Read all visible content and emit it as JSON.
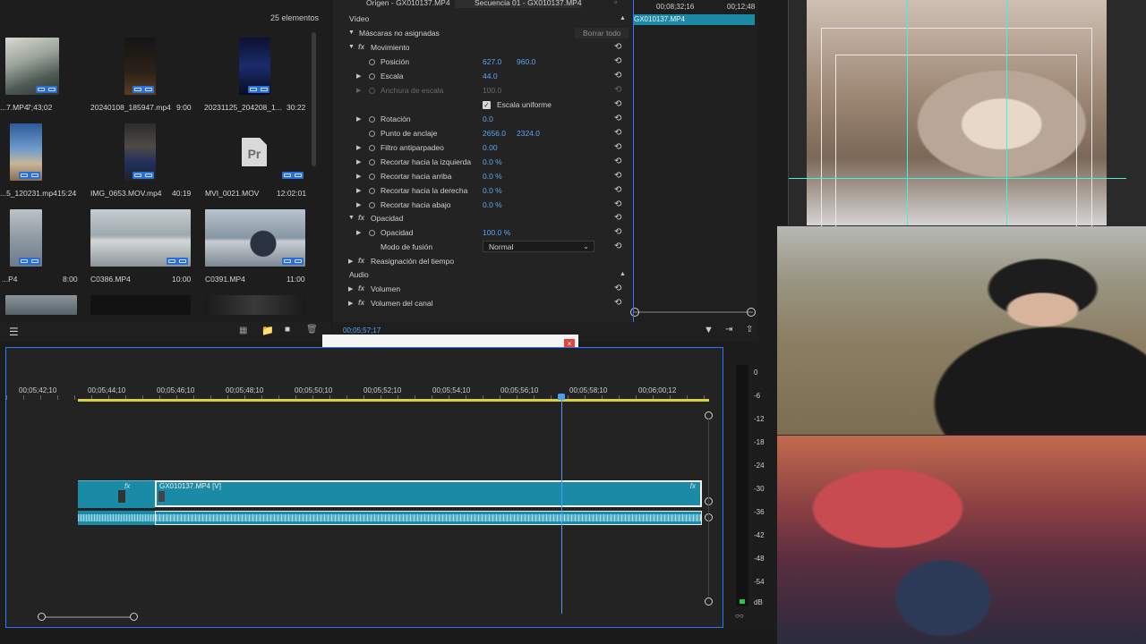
{
  "project_panel": {
    "item_count": "25 elementos",
    "clips": [
      {
        "name": "...7.MP4",
        "duration": "7;43;02"
      },
      {
        "name": "20240108_185947.mp4",
        "duration": "9:00"
      },
      {
        "name": "20231125_204208_1...",
        "duration": "30:22"
      },
      {
        "name": "...5_120231.mp4",
        "duration": "15:24"
      },
      {
        "name": "IMG_0653.MOV.mp4",
        "duration": "40:19"
      },
      {
        "name": "MVI_0021.MOV",
        "duration": "12:02:01"
      },
      {
        "name": "...P4",
        "duration": "8:00"
      },
      {
        "name": "C0386.MP4",
        "duration": "10:00"
      },
      {
        "name": "C0391.MP4",
        "duration": "11:00"
      }
    ]
  },
  "effect_controls": {
    "tab_source": "Origen - GX010137.MP4",
    "tab_sequence": "Secuencia 01 - GX010137.MP4",
    "timecode_start": "00;08;32;16",
    "timecode_end": "00;12;48",
    "clip_label": "GX010137.MP4",
    "section_video": "Vídeo",
    "masks": "Máscaras no asignadas",
    "clear_all": "Borrar todo",
    "motion": "Movimiento",
    "position_label": "Posición",
    "position_x": "627.0",
    "position_y": "960.0",
    "scale_label": "Escala",
    "scale_value": "44.0",
    "scale_width_label": "Anchura de escala",
    "scale_width_value": "100.0",
    "uniform_scale": "Escala uniforme",
    "rotation_label": "Rotación",
    "rotation_value": "0.0",
    "anchor_label": "Punto de anclaje",
    "anchor_x": "2656.0",
    "anchor_y": "2324.0",
    "flicker_label": "Filtro antiparpadeo",
    "flicker_value": "0.00",
    "crop_left_label": "Recortar hacia la izquierda",
    "crop_left_value": "0.0 %",
    "crop_top_label": "Recortar hacia arriba",
    "crop_top_value": "0.0 %",
    "crop_right_label": "Recortar hacia la derecha",
    "crop_right_value": "0.0 %",
    "crop_bottom_label": "Recortar hacia abajo",
    "crop_bottom_value": "0.0 %",
    "opacity_section": "Opacidad",
    "opacity_label": "Opacidad",
    "opacity_value": "100.0 %",
    "blend_label": "Modo de fusión",
    "blend_value": "Normal",
    "time_remap": "Reasignación del tiempo",
    "section_audio": "Audio",
    "volume": "Volumen",
    "channel_volume": "Volumen del canal",
    "footer_timecode": "00;05;57;17"
  },
  "timeline": {
    "ruler": [
      "00;05;42;10",
      "00;05;44;10",
      "00;05;46;10",
      "00;05;48;10",
      "00;05;50;10",
      "00;05;52;10",
      "00;05;54;10",
      "00;05;56;10",
      "00;05;58;10",
      "00;06;00;12"
    ],
    "video_clip_label": "GX010137.MP4 [V]",
    "fx_label": "fx",
    "tools": [
      "selection-tool",
      "track-select-tool",
      "ripple-edit-tool",
      "razor-tool",
      "slip-tool",
      "pen-tool",
      "rectangle-tool",
      "crop-tool",
      "hand-tool",
      "type-tool",
      "auto-reframe-tool"
    ]
  },
  "audio_meter": {
    "scale": [
      "0",
      "-6",
      "-12",
      "-18",
      "-24",
      "-30",
      "-36",
      "-42",
      "-48",
      "-54",
      "dB"
    ]
  },
  "colors": {
    "accent": "#2a78ff",
    "clip_video": "#1b8aa6",
    "value_blue": "#5aa6f5",
    "close_red": "#e0463e"
  }
}
